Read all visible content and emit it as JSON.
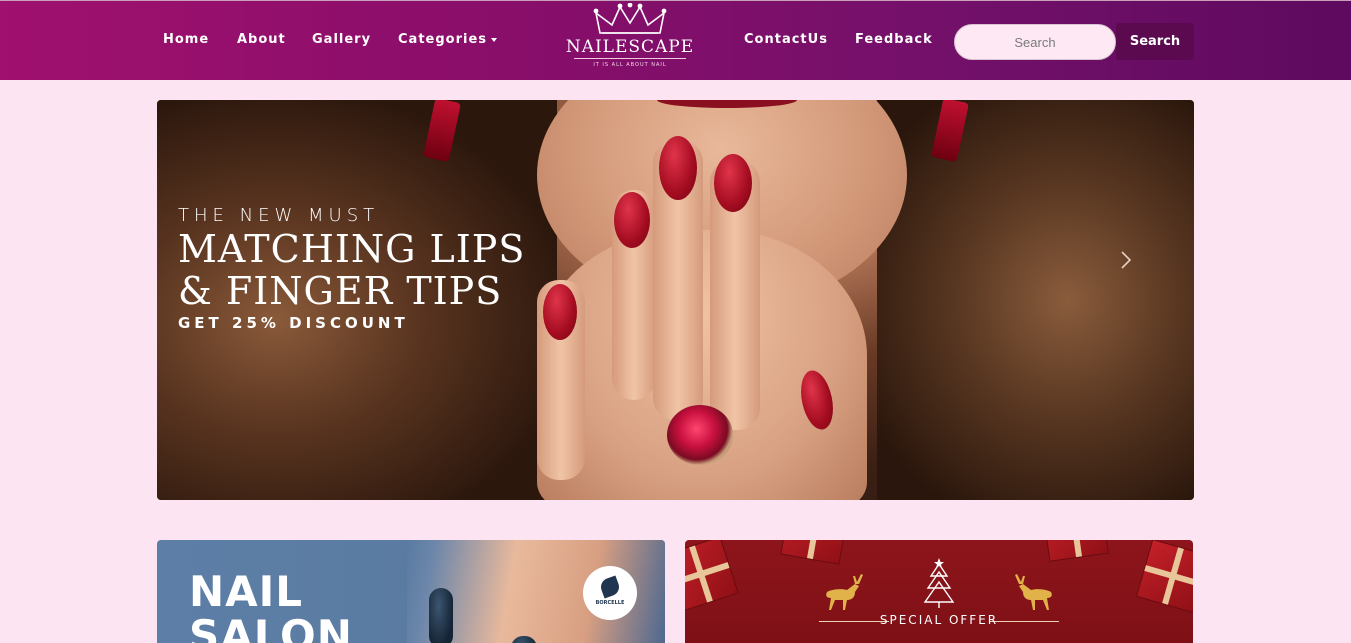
{
  "nav": {
    "links": [
      "Home",
      "About",
      "Gallery",
      "Categories",
      "ContactUs",
      "Feedback"
    ],
    "search_placeholder": "Search",
    "search_button": "Search"
  },
  "logo": {
    "name": "NAILESCAPE",
    "tagline": "IT IS ALL ABOUT NAIL"
  },
  "hero": {
    "kicker": "THE NEW MUST",
    "title_line1": "MATCHING LIPS",
    "title_line2": "& FINGER TIPS",
    "offer": "GET 25% DISCOUNT"
  },
  "promo_salon": {
    "heading_line1": "NAIL",
    "heading_line2": "SALON",
    "brand": "BORCELLE"
  },
  "promo_offer": {
    "label": "SPECIAL OFFER"
  },
  "colors": {
    "nav_start": "#a0106e",
    "nav_end": "#5e0a5e",
    "page_bg": "#fde4f3",
    "search_button_bg": "#5c0a50",
    "offer_bg": "#8d151b",
    "salon_bg": "#5d7fa7"
  }
}
